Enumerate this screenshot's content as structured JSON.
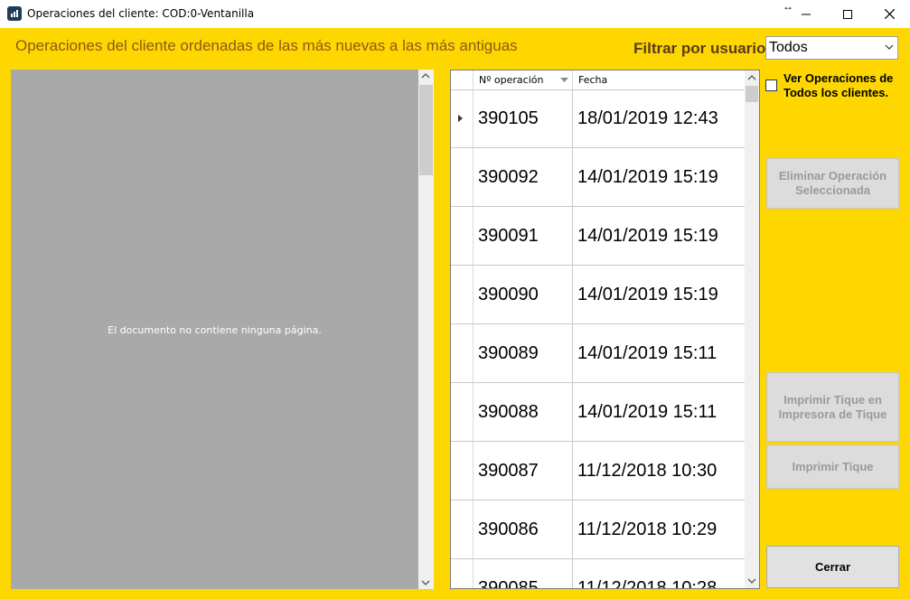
{
  "window": {
    "title": "Operaciones del cliente: COD:0-Ventanilla"
  },
  "header": {
    "label": "Operaciones del cliente ordenadas de las más nuevas a las más antiguas",
    "filter_label": "Filtrar por usuario:",
    "filter_value": "Todos"
  },
  "viewer": {
    "message": "El documento no contiene ninguna página."
  },
  "grid": {
    "columns": [
      "Nº operación",
      "Fecha"
    ],
    "rows": [
      {
        "id": "390105",
        "date": "18/01/2019 12:43"
      },
      {
        "id": "390092",
        "date": "14/01/2019 15:19"
      },
      {
        "id": "390091",
        "date": "14/01/2019 15:19"
      },
      {
        "id": "390090",
        "date": "14/01/2019 15:19"
      },
      {
        "id": "390089",
        "date": "14/01/2019 15:11"
      },
      {
        "id": "390088",
        "date": "14/01/2019 15:11"
      },
      {
        "id": "390087",
        "date": "11/12/2018 10:30"
      },
      {
        "id": "390086",
        "date": "11/12/2018 10:29"
      },
      {
        "id": "390085",
        "date": "11/12/2018 10:28"
      }
    ]
  },
  "options": {
    "all_clients_label": "Ver Operaciones de\nTodos los clientes.",
    "all_clients_checked": false
  },
  "buttons": {
    "delete": "Eliminar Operación Seleccionada",
    "print_ticket_printer": "Imprimir Tique en Impresora de Tique",
    "print_ticket": "Imprimir Tique",
    "close": "Cerrar"
  },
  "colors": {
    "background": "#ffd700",
    "header_text": "#8b5a16",
    "viewer": "#a9a9a9",
    "disabled_button_text": "#9a9a9a"
  }
}
